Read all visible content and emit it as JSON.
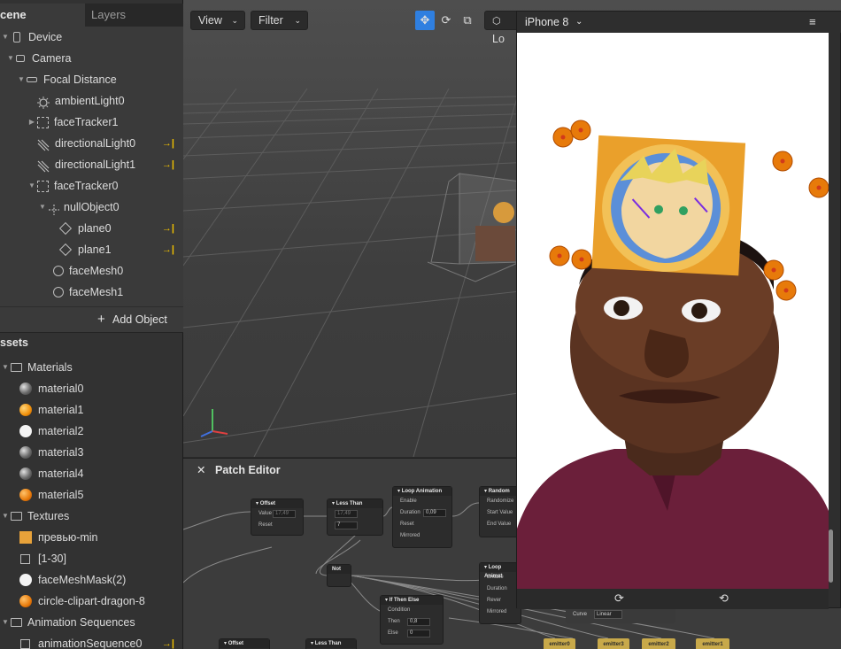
{
  "left_panel": {
    "tab_scene": "cene",
    "tab_layers": "Layers",
    "tree": [
      {
        "label": "Device"
      },
      {
        "label": "Camera"
      },
      {
        "label": "Focal Distance"
      },
      {
        "label": "ambientLight0"
      },
      {
        "label": "faceTracker1"
      },
      {
        "label": "directionalLight0"
      },
      {
        "label": "directionalLight1"
      },
      {
        "label": "faceTracker0"
      },
      {
        "label": "nullObject0"
      },
      {
        "label": "plane0"
      },
      {
        "label": "plane1"
      },
      {
        "label": "faceMesh0"
      },
      {
        "label": "faceMesh1"
      }
    ],
    "add_object": "Add Object",
    "assets_title": "ssets",
    "assets": [
      {
        "label": "Materials"
      },
      {
        "label": "material0"
      },
      {
        "label": "material1"
      },
      {
        "label": "material2"
      },
      {
        "label": "material3"
      },
      {
        "label": "material4"
      },
      {
        "label": "material5"
      },
      {
        "label": "Textures"
      },
      {
        "label": "превью-min"
      },
      {
        "label": "[1-30]"
      },
      {
        "label": "faceMeshMask(2)"
      },
      {
        "label": "circle-clipart-dragon-8"
      },
      {
        "label": "Animation Sequences"
      },
      {
        "label": "animationSequence0"
      }
    ]
  },
  "viewport": {
    "view_label": "View",
    "filter_label": "Filter",
    "local_label": "Lo"
  },
  "patch_editor": {
    "title": "Patch Editor",
    "nodes": {
      "offset": {
        "title": "Offset",
        "value_label": "Value",
        "value": "17,49",
        "reset_label": "Reset"
      },
      "less_than": {
        "title": "Less Than",
        "value": "17,49",
        "value2": "7"
      },
      "loop_animation": {
        "title": "Loop Animation",
        "enable": "Enable",
        "duration": "Duration",
        "duration_value": "0,09",
        "reset": "Reset",
        "mirrored": "Mirrored"
      },
      "random": {
        "title": "Random",
        "randomize": "Randomize",
        "start_value": "Start Value",
        "end_value": "End Value"
      },
      "not": {
        "title": "Not"
      },
      "loop_animation_2": {
        "title": "Loop Animat",
        "enable": "Enable",
        "duration": "Duration",
        "reset": "Rever",
        "mirrored": "Mirrored"
      },
      "if_then_else": {
        "title": "If Then Else",
        "condition": "Condition",
        "then": "Then",
        "then_value": "0,8",
        "else": "Else",
        "else_value": "0"
      },
      "curve": {
        "label": "Curve",
        "value": "Linear"
      },
      "offset_2": {
        "title": "Offset"
      },
      "less_than_2": {
        "title": "Less Than"
      }
    },
    "emitters": [
      "emitter0",
      "emitter3",
      "emitter2",
      "emitter1"
    ]
  },
  "simulator": {
    "device": "iPhone 8"
  }
}
